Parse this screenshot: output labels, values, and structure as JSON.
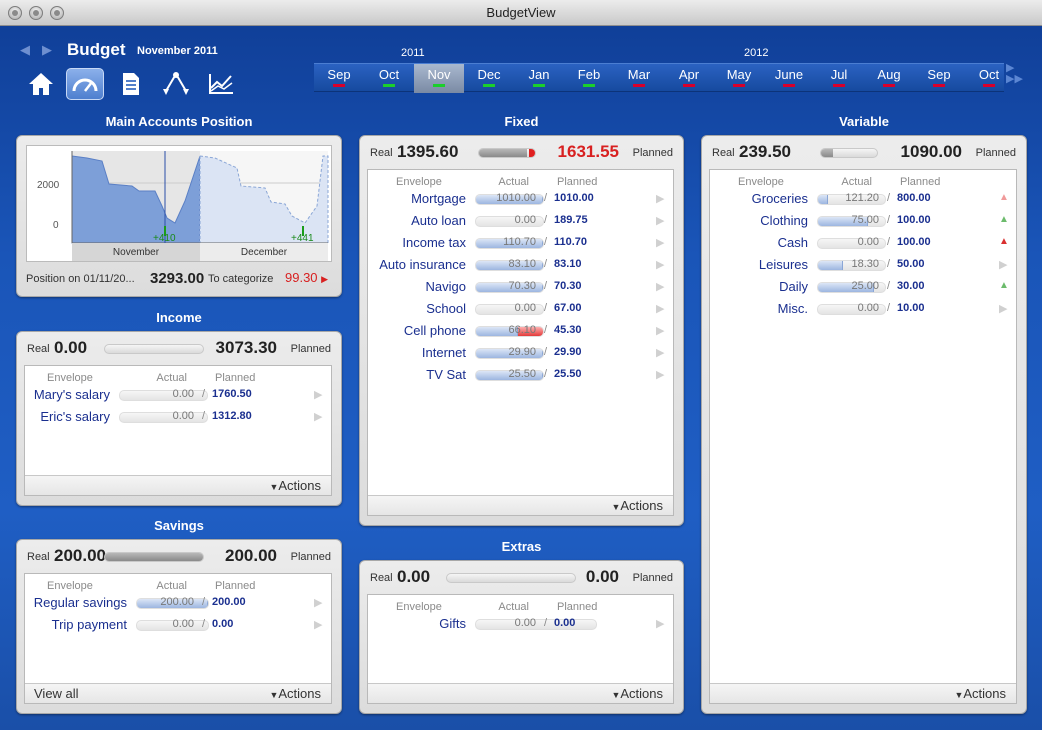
{
  "window": {
    "title": "BudgetView"
  },
  "header": {
    "title": "Budget",
    "month": "November 2011"
  },
  "toolbar": {
    "icons": [
      "home-icon",
      "gauge-icon",
      "document-icon",
      "categorize-icon",
      "analysis-chart-icon"
    ],
    "selected": 1
  },
  "timeline": {
    "years": [
      {
        "label": "2011"
      },
      {
        "label": "2012"
      }
    ],
    "months": [
      {
        "label": "Sep",
        "marker": "#d8002b"
      },
      {
        "label": "Oct",
        "marker": "#1bcf2b"
      },
      {
        "label": "Nov",
        "marker": "#1bcf2b",
        "selected": true
      },
      {
        "label": "Dec",
        "marker": "#1bcf2b"
      },
      {
        "label": "Jan",
        "marker": "#1bcf2b"
      },
      {
        "label": "Feb",
        "marker": "#1bcf2b"
      },
      {
        "label": "Mar",
        "marker": "#d8002b"
      },
      {
        "label": "Apr",
        "marker": "#d8002b"
      },
      {
        "label": "May",
        "marker": "#d8002b"
      },
      {
        "label": "June",
        "marker": "#d8002b"
      },
      {
        "label": "Jul",
        "marker": "#d8002b"
      },
      {
        "label": "Aug",
        "marker": "#d8002b"
      },
      {
        "label": "Sep",
        "marker": "#d8002b"
      },
      {
        "label": "Oct",
        "marker": "#d8002b"
      }
    ]
  },
  "accounts": {
    "title": "Main Accounts Position",
    "chart": {
      "y_tick_2000": "2000",
      "y_tick_0": "0",
      "label_nov": "+410",
      "label_dec": "+441",
      "month1": "November",
      "month2": "December"
    },
    "position_label": "Position on 01/11/20...",
    "position_value": "3293.00",
    "categorize_label": "To categorize",
    "categorize_value": "99.30"
  },
  "income": {
    "title": "Income",
    "real_label": "Real",
    "real": "0.00",
    "planned": "3073.30",
    "planned_label": "Planned",
    "gauge": 0,
    "headers": {
      "envelope": "Envelope",
      "actual": "Actual",
      "planned": "Planned"
    },
    "rows": [
      {
        "name": "Mary's salary",
        "actual": "0.00",
        "planned": "1760.50",
        "fill": 0
      },
      {
        "name": "Eric's salary",
        "actual": "0.00",
        "planned": "1312.80",
        "fill": 0
      }
    ],
    "actions": "Actions"
  },
  "savings": {
    "title": "Savings",
    "real_label": "Real",
    "real": "200.00",
    "planned": "200.00",
    "planned_label": "Planned",
    "gauge": 1,
    "headers": {
      "envelope": "Envelope",
      "actual": "Actual",
      "planned": "Planned"
    },
    "rows": [
      {
        "name": "Regular savings",
        "actual": "200.00",
        "planned": "200.00",
        "fill": 1
      },
      {
        "name": "Trip payment",
        "actual": "0.00",
        "planned": "0.00",
        "fill": 0
      }
    ],
    "view_all": "View all",
    "actions": "Actions"
  },
  "fixed": {
    "title": "Fixed",
    "real_label": "Real",
    "real": "1395.60",
    "planned": "1631.55",
    "planned_label": "Planned",
    "gauge": 0.85,
    "headers": {
      "envelope": "Envelope",
      "actual": "Actual",
      "planned": "Planned"
    },
    "rows": [
      {
        "name": "Mortgage",
        "actual": "1010.00",
        "planned": "1010.00",
        "fill": 1
      },
      {
        "name": "Auto loan",
        "actual": "0.00",
        "planned": "189.75",
        "fill": 0
      },
      {
        "name": "Income tax",
        "actual": "110.70",
        "planned": "110.70",
        "fill": 1
      },
      {
        "name": "Auto insurance",
        "actual": "83.10",
        "planned": "83.10",
        "fill": 1
      },
      {
        "name": "Navigo",
        "actual": "70.30",
        "planned": "70.30",
        "fill": 1
      },
      {
        "name": "School",
        "actual": "0.00",
        "planned": "67.00",
        "fill": 0
      },
      {
        "name": "Cell phone",
        "actual": "66.10",
        "planned": "45.30",
        "fill": 1,
        "over": true
      },
      {
        "name": "Internet",
        "actual": "29.90",
        "planned": "29.90",
        "fill": 1
      },
      {
        "name": "TV Sat",
        "actual": "25.50",
        "planned": "25.50",
        "fill": 1
      }
    ],
    "actions": "Actions"
  },
  "extras": {
    "title": "Extras",
    "real_label": "Real",
    "real": "0.00",
    "planned": "0.00",
    "planned_label": "Planned",
    "gauge": 0,
    "headers": {
      "envelope": "Envelope",
      "actual": "Actual",
      "planned": "Planned"
    },
    "rows": [
      {
        "name": "Gifts",
        "actual": "0.00",
        "planned": "0.00",
        "fill": 0
      }
    ],
    "actions": "Actions"
  },
  "variable": {
    "title": "Variable",
    "real_label": "Real",
    "real": "239.50",
    "planned": "1090.00",
    "planned_label": "Planned",
    "gauge": 0.22,
    "headers": {
      "envelope": "Envelope",
      "actual": "Actual",
      "planned": "Planned"
    },
    "rows": [
      {
        "name": "Groceries",
        "actual": "121.20",
        "planned": "800.00",
        "fill": 0.15,
        "trend": "#f09a9a"
      },
      {
        "name": "Clothing",
        "actual": "75.00",
        "planned": "100.00",
        "fill": 0.75,
        "trend": "#6cbb6c"
      },
      {
        "name": "Cash",
        "actual": "0.00",
        "planned": "100.00",
        "fill": 0,
        "trend": "#d93030"
      },
      {
        "name": "Leisures",
        "actual": "18.30",
        "planned": "50.00",
        "fill": 0.37
      },
      {
        "name": "Daily",
        "actual": "25.00",
        "planned": "30.00",
        "fill": 0.83,
        "trend": "#6cbb6c"
      },
      {
        "name": "Misc.",
        "actual": "0.00",
        "planned": "10.00",
        "fill": 0
      }
    ],
    "actions": "Actions"
  }
}
